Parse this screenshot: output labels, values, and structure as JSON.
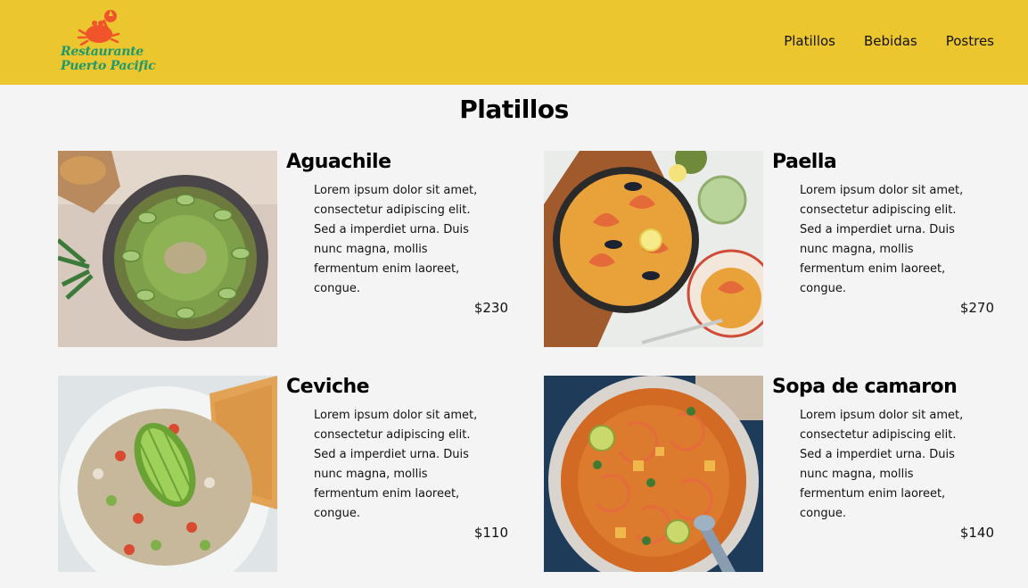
{
  "header": {
    "logo_line1": "Restaurante",
    "logo_line2": "Puerto Pacific",
    "nav": [
      "Platillos",
      "Bebidas",
      "Postres"
    ],
    "background": "#ecc62e",
    "logo_color": "#1d9a6c",
    "crab_color": "#f0542a"
  },
  "page": {
    "title": "Platillos"
  },
  "dishes": [
    {
      "name": "Aguachile",
      "description": "Lorem ipsum dolor sit amet, consectetur adipiscing elit. Sed a imperdiet urna. Duis nunc magna, mollis fermentum enim laoreet, congue.",
      "price": "$230"
    },
    {
      "name": "Paella",
      "description": "Lorem ipsum dolor sit amet, consectetur adipiscing elit. Sed a imperdiet urna. Duis nunc magna, mollis fermentum enim laoreet, congue.",
      "price": "$270"
    },
    {
      "name": "Ceviche",
      "description": "Lorem ipsum dolor sit amet, consectetur adipiscing elit. Sed a imperdiet urna. Duis nunc magna, mollis fermentum enim laoreet, congue.",
      "price": "$110"
    },
    {
      "name": "Sopa de camaron",
      "description": "Lorem ipsum dolor sit amet, consectetur adipiscing elit. Sed a imperdiet urna. Duis nunc magna, mollis fermentum enim laoreet, congue.",
      "price": "$140"
    }
  ]
}
